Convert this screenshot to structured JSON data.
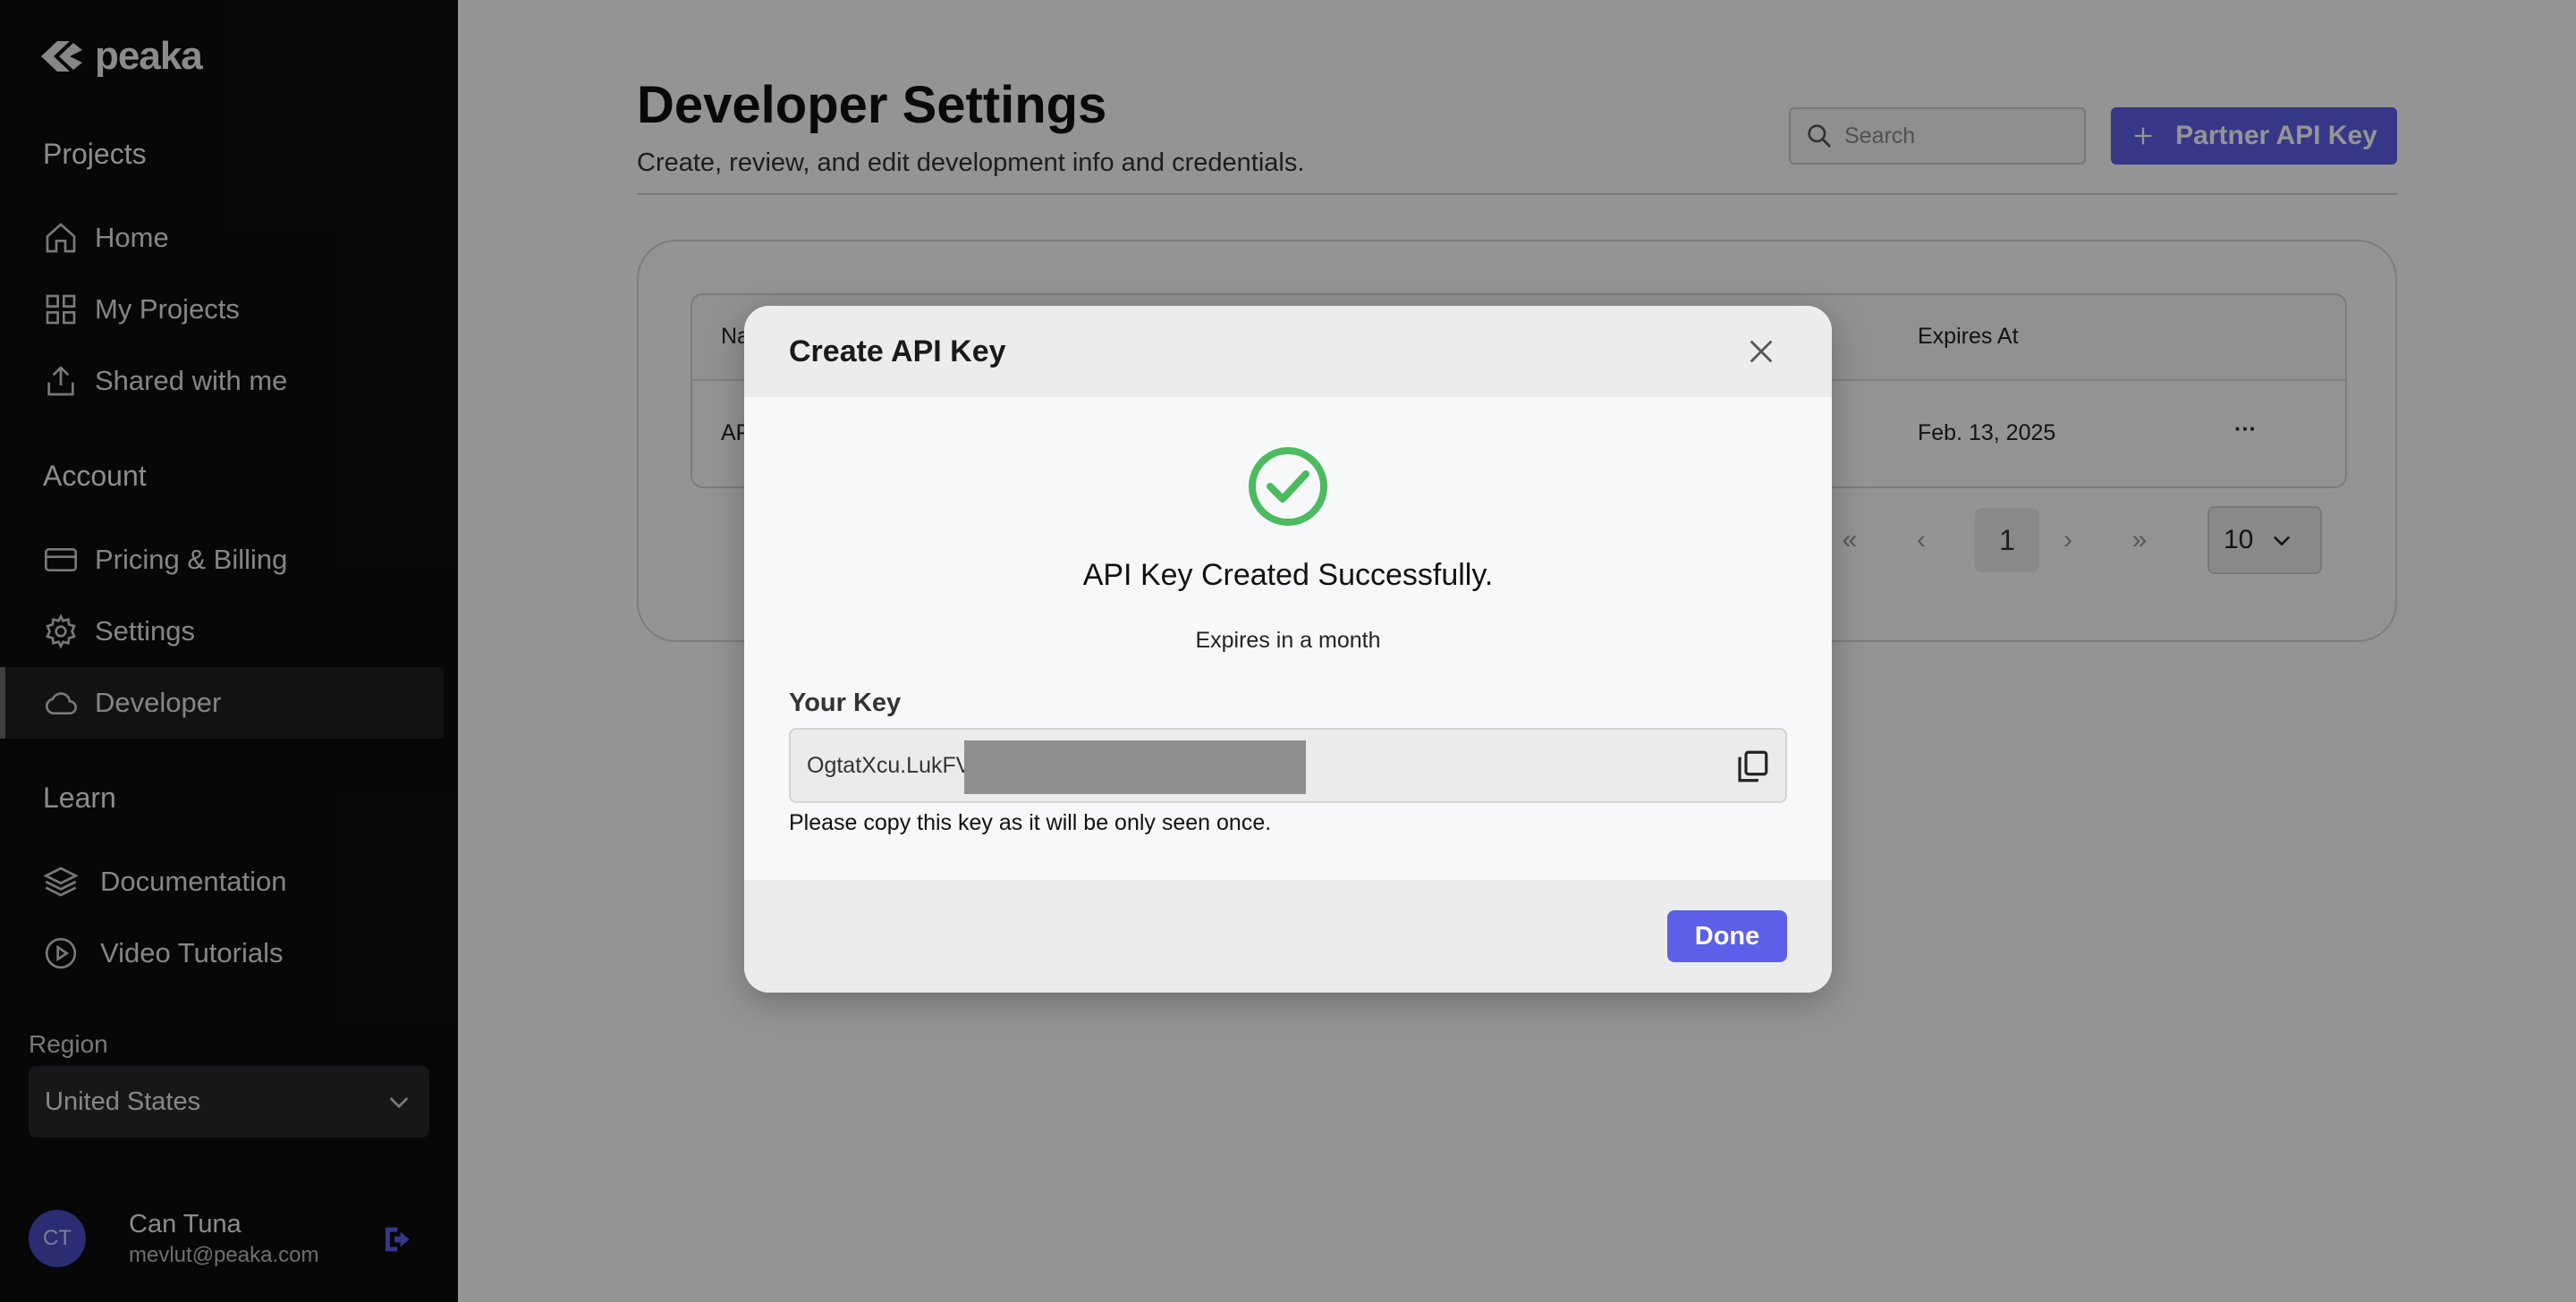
{
  "brand": {
    "name": "peaka"
  },
  "sidebar": {
    "projects_title": "Projects",
    "projects_items": [
      {
        "label": "Home",
        "icon": "home-icon"
      },
      {
        "label": "My Projects",
        "icon": "grid-icon"
      },
      {
        "label": "Shared with me",
        "icon": "share-icon"
      }
    ],
    "account_title": "Account",
    "account_items": [
      {
        "label": "Pricing & Billing",
        "icon": "credit-card-icon"
      },
      {
        "label": "Settings",
        "icon": "gear-icon"
      },
      {
        "label": "Developer",
        "icon": "cloud-icon"
      }
    ],
    "learn_title": "Learn",
    "learn_items": [
      {
        "label": "Documentation",
        "icon": "layers-icon"
      },
      {
        "label": "Video Tutorials",
        "icon": "play-circle-icon"
      }
    ],
    "region_label": "Region",
    "region_value": "United States",
    "user": {
      "initials": "CT",
      "name": "Can Tuna",
      "email": "mevlut@peaka.com"
    }
  },
  "header": {
    "title": "Developer Settings",
    "subtitle": "Create, review, and edit development info and credentials.",
    "search_placeholder": "Search",
    "partner_button": "Partner API Key"
  },
  "table": {
    "columns": {
      "name": "Na",
      "expires_at": "Expires At"
    },
    "rows": [
      {
        "name": "AP",
        "expires_at": "Feb. 13, 2025",
        "actions": "···"
      }
    ]
  },
  "pagination": {
    "first": "«",
    "prev": "‹",
    "current": "1",
    "next": "›",
    "last": "»",
    "page_size": "10"
  },
  "modal": {
    "title": "Create API Key",
    "success_message": "API Key Created Successfully.",
    "expires_message": "Expires in a month",
    "key_label": "Your Key",
    "key_value": "OgtatXcu.LukFV",
    "key_hint": "Please copy this key as it will be only seen once.",
    "done_button": "Done"
  },
  "colors": {
    "accent": "#5d5fe8",
    "success": "#4cbb5f",
    "sidebar_bg": "#0d0d0e"
  }
}
